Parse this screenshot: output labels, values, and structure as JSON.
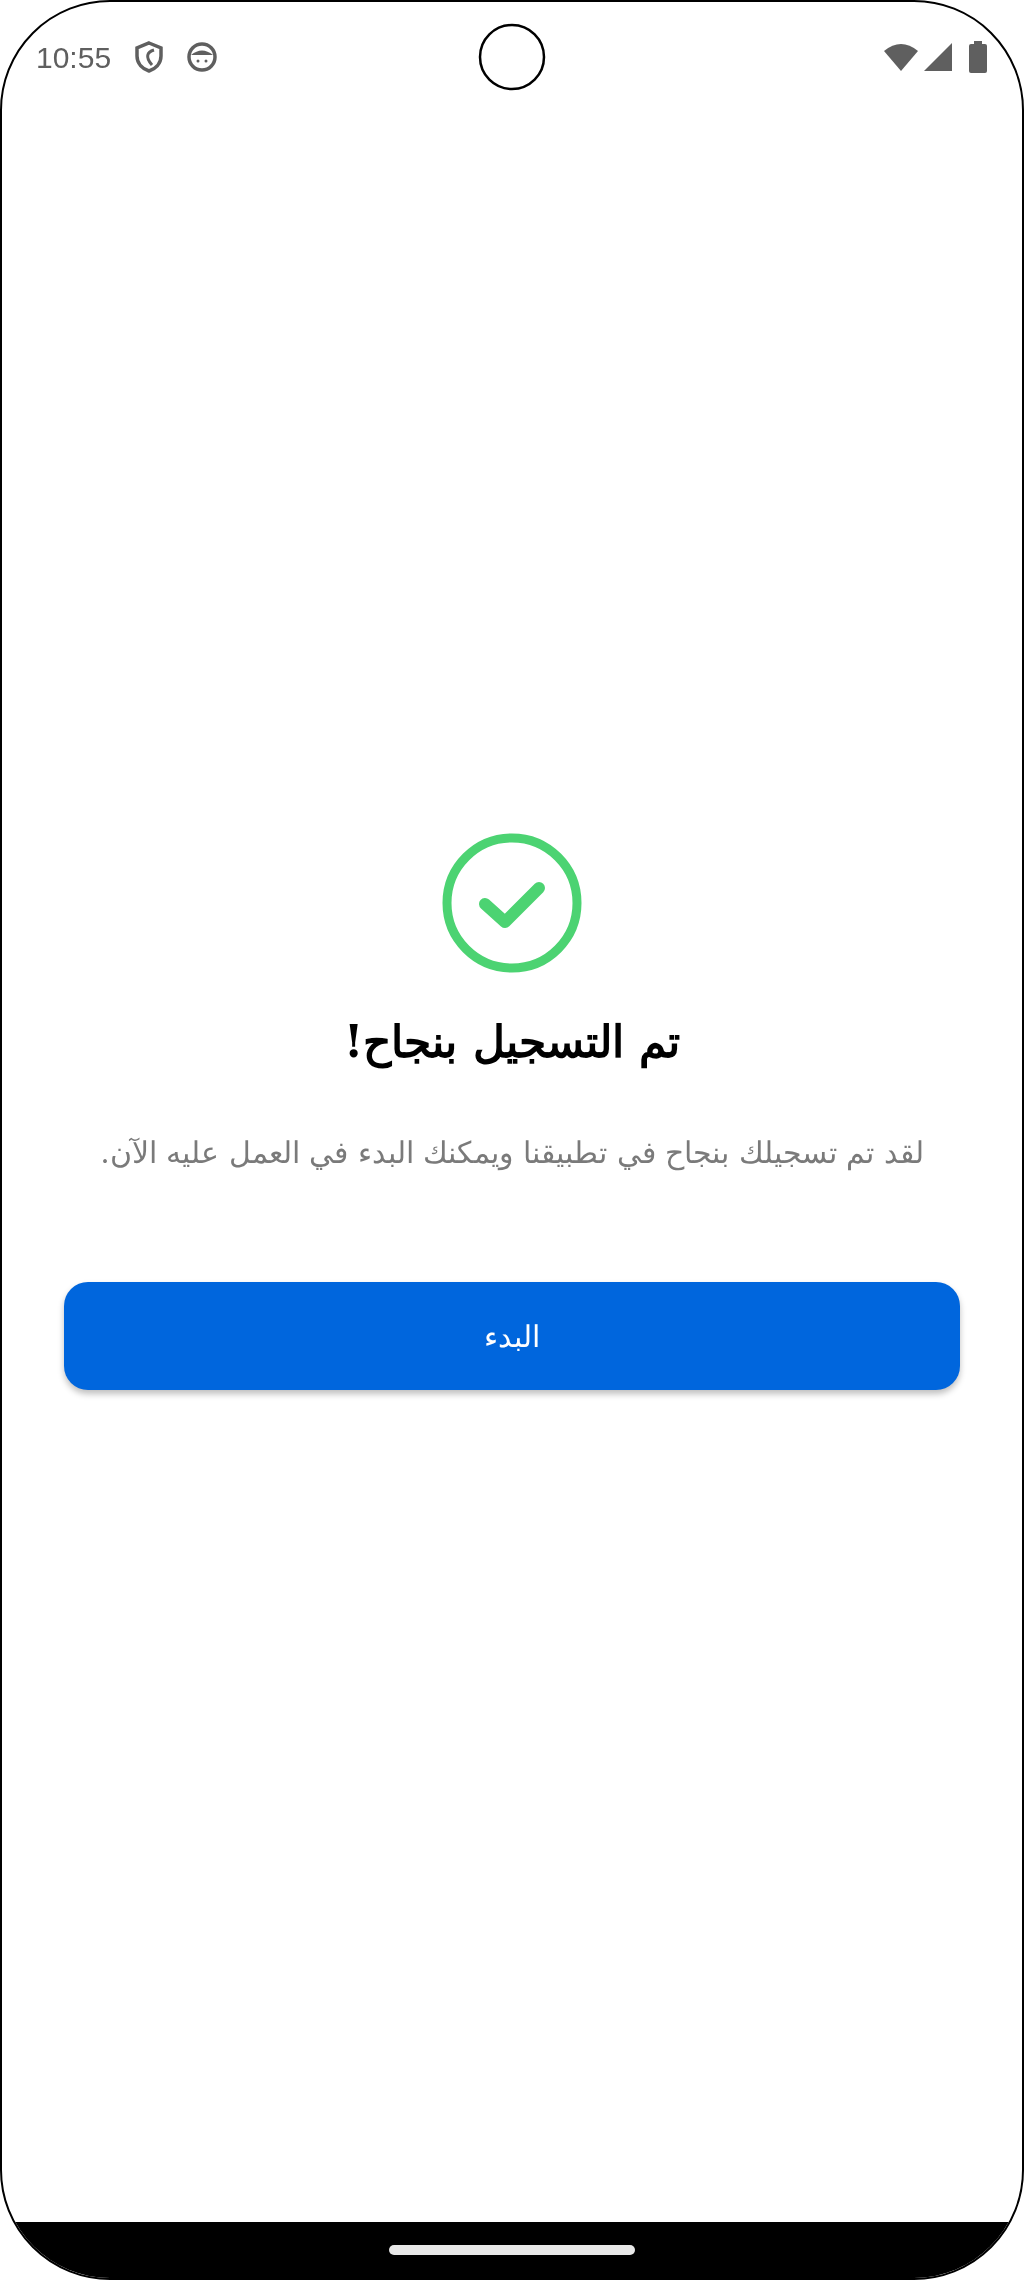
{
  "status_bar": {
    "time": "10:55"
  },
  "title": "تم التسجيل بنجاح!",
  "message": "لقد تم تسجيلك بنجاح في تطبيقنا ويمكنك البدء في العمل عليه الآن.",
  "buttons": [
    {
      "label": "البدء",
      "kind": "primary"
    }
  ]
}
